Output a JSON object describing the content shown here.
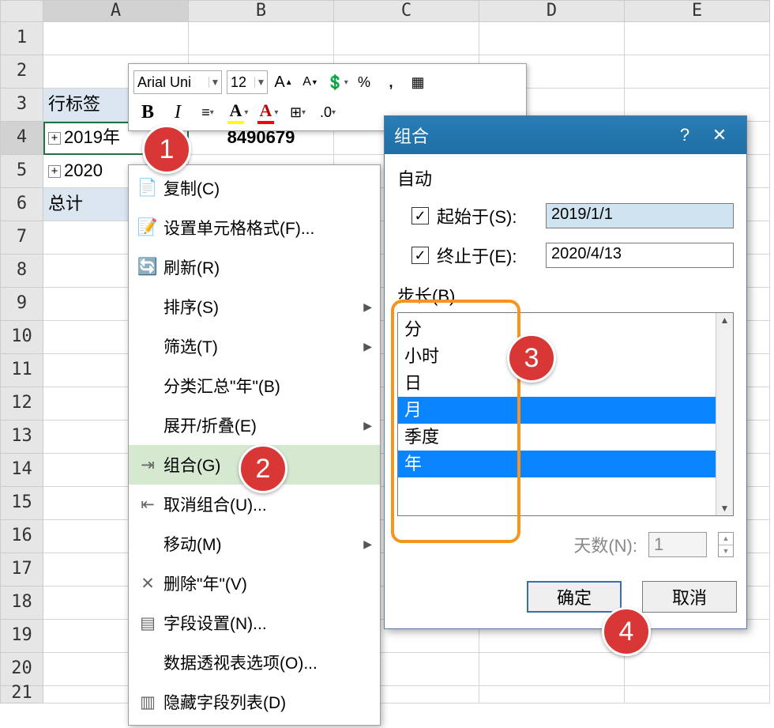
{
  "columns": [
    "A",
    "B",
    "C",
    "D",
    "E"
  ],
  "rows": [
    "1",
    "2",
    "3",
    "4",
    "5",
    "6",
    "7",
    "8",
    "9",
    "10",
    "11",
    "12",
    "13",
    "14",
    "15",
    "16",
    "17",
    "18",
    "19",
    "20",
    "21"
  ],
  "sheet": {
    "a3": "行标签",
    "a4": "2019年",
    "b4": "8490679",
    "a5": "2020",
    "a6": "总计"
  },
  "mini": {
    "font": "Arial Uni",
    "size": "12",
    "grow": "A",
    "shrink": "A",
    "currency": "¥",
    "percent": "%",
    "comma": ",",
    "bold": "B",
    "italic": "I"
  },
  "ctx": {
    "copy": "复制(C)",
    "format_cells": "设置单元格格式(F)...",
    "refresh": "刷新(R)",
    "sort": "排序(S)",
    "filter": "筛选(T)",
    "subtotal": "分类汇总\"年\"(B)",
    "expand": "展开/折叠(E)",
    "group": "组合(G)",
    "ungroup": "取消组合(U)...",
    "move": "移动(M)",
    "delete": "删除\"年\"(V)",
    "field_settings": "字段设置(N)...",
    "pivot_options": "数据透视表选项(O)...",
    "hide_fields": "隐藏字段列表(D)"
  },
  "dlg": {
    "title": "组合",
    "auto": "自动",
    "start_lbl": "起始于(S):",
    "end_lbl": "终止于(E):",
    "start_val": "2019/1/1",
    "end_val": "2020/4/13",
    "step_lbl": "步长(B)",
    "items": {
      "minute": "分",
      "hour": "小时",
      "day": "日",
      "month": "月",
      "quarter": "季度",
      "year": "年"
    },
    "days_lbl": "天数(N):",
    "days_val": "1",
    "ok": "确定",
    "cancel": "取消"
  },
  "badges": {
    "b1": "1",
    "b2": "2",
    "b3": "3",
    "b4": "4"
  }
}
